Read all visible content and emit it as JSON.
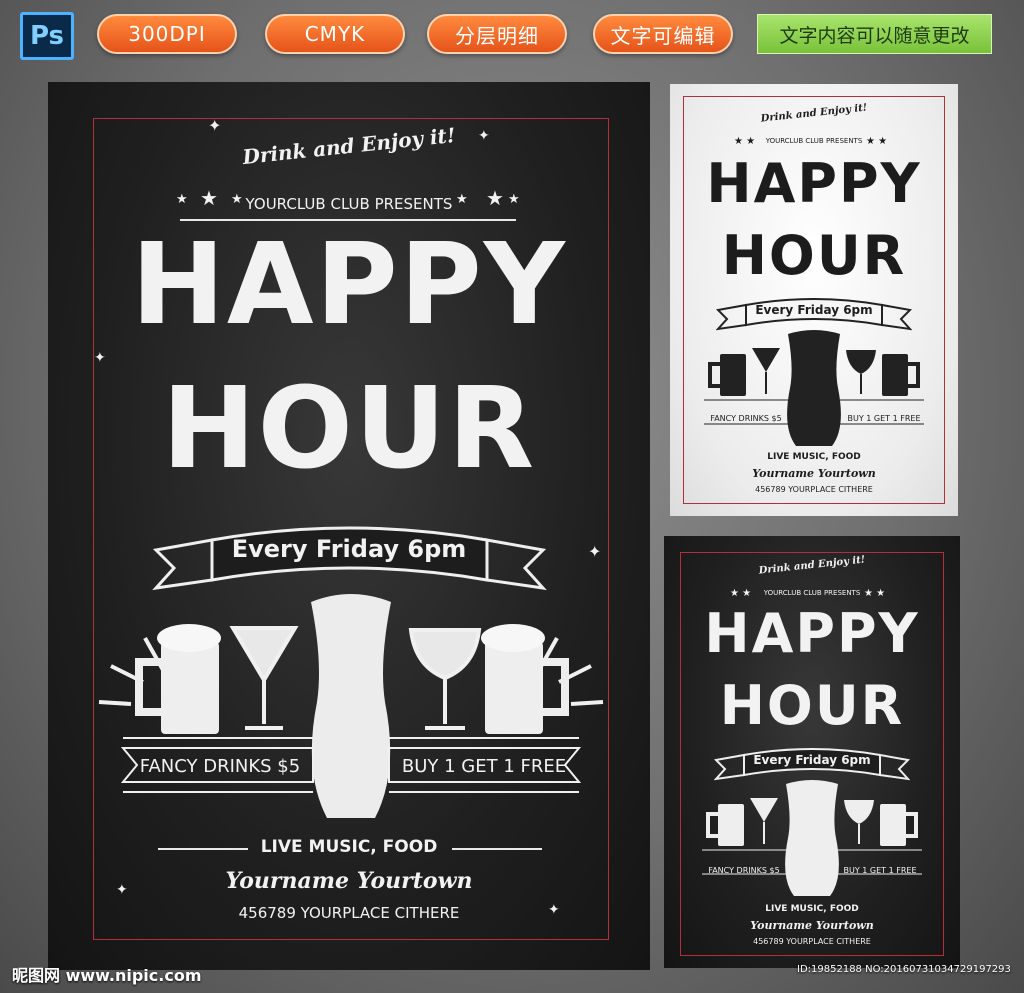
{
  "badges": {
    "ps": "Ps",
    "dpi": "300DPI",
    "color_mode": "CMYK",
    "layers": "分层明细",
    "editable": "文字可编辑",
    "note": "文字内容可以随意更改"
  },
  "poster": {
    "tagline": "Drink and Enjoy it!",
    "presents": "YOURCLUB CLUB PRESENTS",
    "title_line1": "HAPPY",
    "title_line2": "HOUR",
    "banner": "Every Friday 6pm",
    "left_offer": "FANCY DRINKS $5",
    "right_offer": "BUY 1 GET 1 FREE",
    "extras": "LIVE MUSIC,   FOOD",
    "venue": "Yourname Yourtown",
    "address": "456789 YOURPLACE CITHERE"
  },
  "footer": {
    "site": "昵图网 www.nipic.com",
    "id": "ID:19852188 NO:20160731034729197293"
  },
  "colors": {
    "chalkboard": "#1f1f1f",
    "chalk": "#f2f2f2",
    "frame_red": "#b3303a",
    "badge_orange": "#f06a25",
    "badge_green": "#8fd14f"
  }
}
